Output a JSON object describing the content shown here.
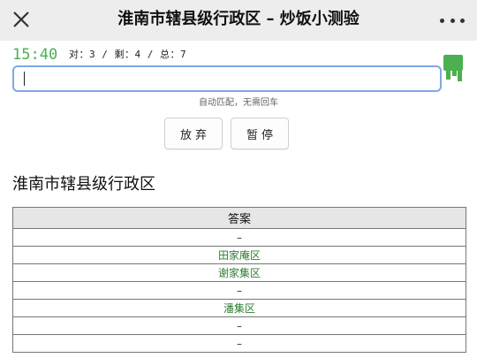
{
  "header": {
    "title": "淮南市辖县级行政区 – 炒饭小测验"
  },
  "status": {
    "timer": "15:40",
    "stats": "对：3 / 剩：4 / 总：7"
  },
  "input": {
    "value": "",
    "hint": "自动匹配，无需回车"
  },
  "buttons": {
    "give_up": "放弃",
    "pause": "暂停"
  },
  "quiz": {
    "title": "淮南市辖县级行政区",
    "column_header": "答案",
    "rows": [
      {
        "text": "–",
        "found": false
      },
      {
        "text": "田家庵区",
        "found": true
      },
      {
        "text": "谢家集区",
        "found": true
      },
      {
        "text": "–",
        "found": false
      },
      {
        "text": "潘集区",
        "found": true
      },
      {
        "text": "–",
        "found": false
      },
      {
        "text": "–",
        "found": false
      }
    ]
  },
  "colors": {
    "timer": "#4caf50",
    "found_text": "#2e7d32",
    "input_border": "#7fa7e6",
    "header_bg": "#ededed"
  },
  "icons": {
    "close": "close-icon",
    "more": "more-icon",
    "side": "green-badge-icon"
  }
}
